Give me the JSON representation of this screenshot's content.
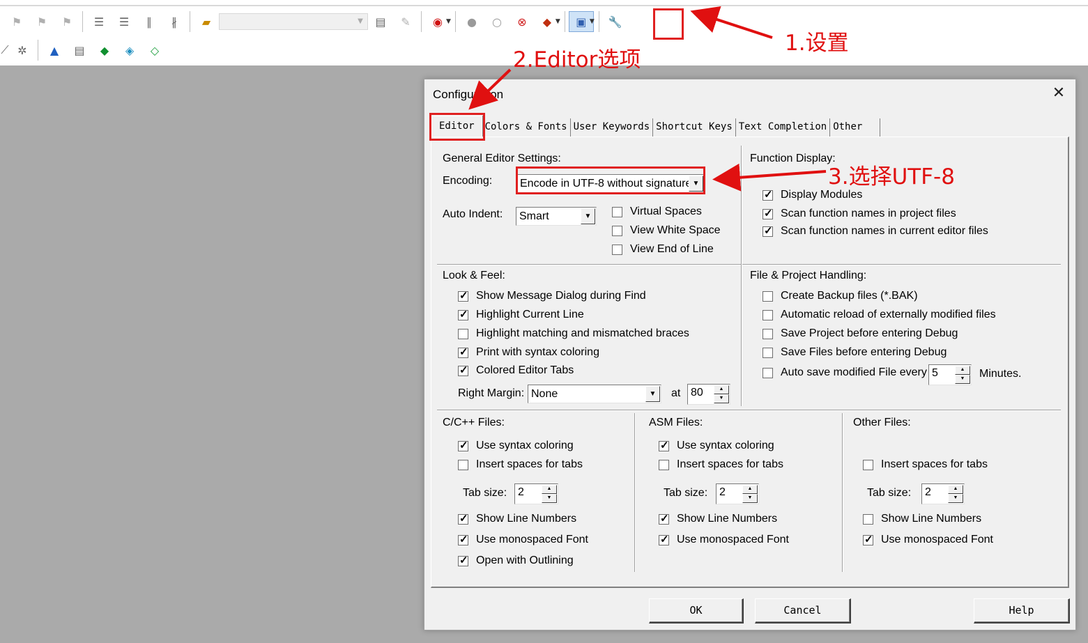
{
  "annotations": {
    "step1": "1.设置",
    "step2": "2.Editor选项",
    "step3": "3.选择UTF-8"
  },
  "toolbar": {
    "row1_icons": [
      "bookmark-toggle-icon",
      "bookmark-prev-icon",
      "bookmark-next-icon",
      "indent-icon",
      "unindent-icon",
      "comment-icon",
      "uncomment-icon",
      "open-file-icon",
      "find-in-files-icon",
      "browse-icon",
      "debug-session-icon",
      "breakpoint-icon",
      "breakpoint-disabled-icon",
      "kill-breakpoints-icon",
      "window-layout-icon",
      "configuration-wrench-icon"
    ],
    "row2_icons": [
      "pack-installer-icon",
      "manage-run-time-icon",
      "select-packs-icon",
      "project-items-icon",
      "options-icon",
      "batch-build-icon"
    ]
  },
  "dialog": {
    "title": "Configuration",
    "close": "✕",
    "tabs": [
      "Editor",
      "Colors & Fonts",
      "User Keywords",
      "Shortcut Keys",
      "Text Completion",
      "Other"
    ],
    "active_tab": "Editor",
    "general": {
      "heading": "General Editor Settings:",
      "encoding_label": "Encoding:",
      "encoding_value": "Encode in UTF-8 without signature",
      "auto_indent_label": "Auto Indent:",
      "auto_indent_value": "Smart",
      "virtual_spaces": {
        "label": "Virtual Spaces",
        "checked": false
      },
      "view_white_space": {
        "label": "View White Space",
        "checked": false
      },
      "view_end_of_line": {
        "label": "View End of Line",
        "checked": false
      }
    },
    "function_display": {
      "heading": "Function Display:",
      "display_modules": {
        "label": "Display Modules",
        "checked": true
      },
      "scan_project": {
        "label": "Scan function names in project files",
        "checked": true
      },
      "scan_editor": {
        "label": "Scan function names in current editor files",
        "checked": true
      }
    },
    "look_feel": {
      "heading": "Look & Feel:",
      "show_message": {
        "label": "Show Message Dialog during Find",
        "checked": true
      },
      "highlight_line": {
        "label": "Highlight Current Line",
        "checked": true
      },
      "highlight_braces": {
        "label": "Highlight matching and mismatched braces",
        "checked": false
      },
      "print_syntax": {
        "label": "Print with syntax coloring",
        "checked": true
      },
      "colored_tabs": {
        "label": "Colored Editor Tabs",
        "checked": true
      },
      "right_margin_label": "Right Margin:",
      "right_margin_value": "None",
      "at_label": "at",
      "at_value": "80"
    },
    "file_project": {
      "heading": "File & Project Handling:",
      "create_backup": {
        "label": "Create Backup files (*.BAK)",
        "checked": false
      },
      "auto_reload": {
        "label": "Automatic reload of externally modified files",
        "checked": false
      },
      "save_project": {
        "label": "Save Project before entering Debug",
        "checked": false
      },
      "save_files": {
        "label": "Save Files before entering Debug",
        "checked": false
      },
      "auto_save": {
        "label": "Auto save modified File every",
        "checked": false
      },
      "auto_save_value": "5",
      "minutes_label": "Minutes."
    },
    "cpp_files": {
      "heading": "C/C++ Files:",
      "syntax": {
        "label": "Use syntax coloring",
        "checked": true
      },
      "spaces": {
        "label": "Insert spaces for tabs",
        "checked": false
      },
      "tab_size_label": "Tab size:",
      "tab_size": "2",
      "line_numbers": {
        "label": "Show Line Numbers",
        "checked": true
      },
      "monospaced": {
        "label": "Use monospaced Font",
        "checked": true
      },
      "outlining": {
        "label": "Open with Outlining",
        "checked": true
      }
    },
    "asm_files": {
      "heading": "ASM Files:",
      "syntax": {
        "label": "Use syntax coloring",
        "checked": true
      },
      "spaces": {
        "label": "Insert spaces for tabs",
        "checked": false
      },
      "tab_size_label": "Tab size:",
      "tab_size": "2",
      "line_numbers": {
        "label": "Show Line Numbers",
        "checked": true
      },
      "monospaced": {
        "label": "Use monospaced Font",
        "checked": true
      }
    },
    "other_files": {
      "heading": "Other Files:",
      "spaces": {
        "label": "Insert spaces for tabs",
        "checked": false
      },
      "tab_size_label": "Tab size:",
      "tab_size": "2",
      "line_numbers": {
        "label": "Show Line Numbers",
        "checked": false
      },
      "monospaced": {
        "label": "Use monospaced Font",
        "checked": true
      }
    },
    "buttons": {
      "ok": "OK",
      "cancel": "Cancel",
      "help": "Help"
    }
  },
  "colors": {
    "annotation": "#e01010",
    "dialog_bg": "#f0f0f0",
    "workspace_bg": "#aaaaaa"
  }
}
